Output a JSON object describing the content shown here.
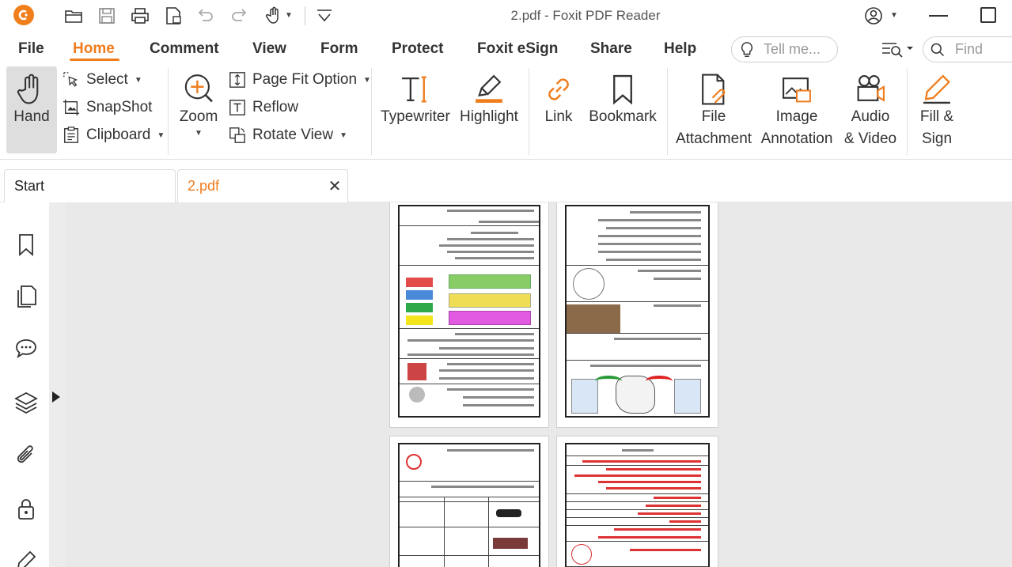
{
  "window": {
    "title": "2.pdf - Foxit PDF Reader"
  },
  "quick_access": {
    "icons": [
      "open-folder-icon",
      "save-icon",
      "print-icon",
      "export-icon",
      "undo-icon",
      "redo-icon",
      "hand-tool-icon",
      "customize-icon"
    ]
  },
  "menu": {
    "tabs": [
      {
        "label": "File"
      },
      {
        "label": "Home"
      },
      {
        "label": "Comment"
      },
      {
        "label": "View"
      },
      {
        "label": "Form"
      },
      {
        "label": "Protect"
      },
      {
        "label": "Foxit eSign"
      },
      {
        "label": "Share"
      },
      {
        "label": "Help"
      }
    ],
    "active": "Home",
    "tell_me_placeholder": "Tell me...",
    "find_placeholder": "Find"
  },
  "ribbon": {
    "hand": "Hand",
    "select": "Select",
    "snapshot": "SnapShot",
    "clipboard": "Clipboard",
    "zoom": "Zoom",
    "page_fit": "Page Fit Option",
    "reflow": "Reflow",
    "rotate": "Rotate View",
    "typewriter": "Typewriter",
    "highlight": "Highlight",
    "link": "Link",
    "bookmark": "Bookmark",
    "file_attachment_1": "File",
    "file_attachment_2": "Attachment",
    "image_annotation_1": "Image",
    "image_annotation_2": "Annotation",
    "audio_video_1": "Audio",
    "audio_video_2": "& Video",
    "fill_sign_1": "Fill &",
    "fill_sign_2": "Sign"
  },
  "doc_tabs": [
    {
      "label": "Start"
    },
    {
      "label": "2.pdf"
    }
  ],
  "colors": {
    "accent": "#ef7d1e",
    "hand_bg": "#dedede",
    "doc_bg": "#e9e9e9"
  }
}
